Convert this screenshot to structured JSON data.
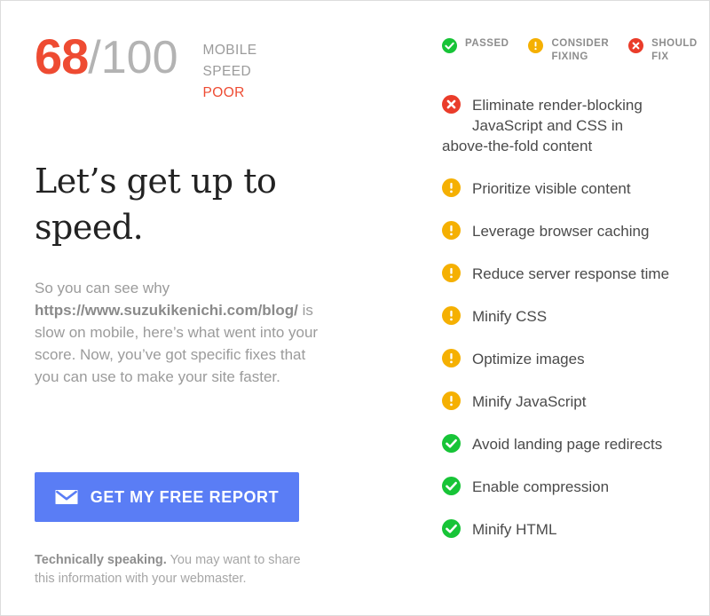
{
  "score": {
    "value": "68",
    "separator_and_total": "/100",
    "device_line1": "MOBILE",
    "device_line2": "SPEED",
    "rating": "POOR",
    "value_color": "#ee4b32",
    "total_color": "#b3b3b3",
    "rating_color": "#ee4b32"
  },
  "headline": "Let’s get up to speed.",
  "lead": {
    "before_url": "So you can see why ",
    "url": "https://www.suzukikenichi.com/blog/",
    "after_url": " is slow on mobile, here’s what went into your score. Now, you’ve got specific fixes that you can use to make your site faster."
  },
  "cta": {
    "label": "GET MY FREE REPORT",
    "icon": "envelope-icon",
    "background_color": "#5a7df5"
  },
  "fine_print": {
    "strong": "Technically speaking.",
    "rest": " You may want to share this information with your webmaster."
  },
  "legend": {
    "items": [
      {
        "status": "passed",
        "icon": "check-circle-icon",
        "line1": "PASSED",
        "line2": "",
        "color": "#17c437"
      },
      {
        "status": "consider",
        "icon": "exclamation-circle-icon",
        "line1": "CONSIDER",
        "line2": "FIXING",
        "color": "#f5b002"
      },
      {
        "status": "fail",
        "icon": "x-circle-icon",
        "line1": "SHOULD",
        "line2": "FIX",
        "color": "#ea3c2a"
      }
    ]
  },
  "audits": [
    {
      "status": "fail",
      "icon": "x-circle-icon",
      "text": "Eliminate render-blocking JavaScript and CSS in",
      "overflow_text": "above-the-fold content"
    },
    {
      "status": "consider",
      "icon": "exclamation-circle-icon",
      "text": "Prioritize visible content"
    },
    {
      "status": "consider",
      "icon": "exclamation-circle-icon",
      "text": "Leverage browser caching"
    },
    {
      "status": "consider",
      "icon": "exclamation-circle-icon",
      "text": "Reduce server response time"
    },
    {
      "status": "consider",
      "icon": "exclamation-circle-icon",
      "text": "Minify CSS"
    },
    {
      "status": "consider",
      "icon": "exclamation-circle-icon",
      "text": "Optimize images"
    },
    {
      "status": "consider",
      "icon": "exclamation-circle-icon",
      "text": "Minify JavaScript"
    },
    {
      "status": "passed",
      "icon": "check-circle-icon",
      "text": "Avoid landing page redirects"
    },
    {
      "status": "passed",
      "icon": "check-circle-icon",
      "text": "Enable compression"
    },
    {
      "status": "passed",
      "icon": "check-circle-icon",
      "text": "Minify HTML"
    }
  ]
}
